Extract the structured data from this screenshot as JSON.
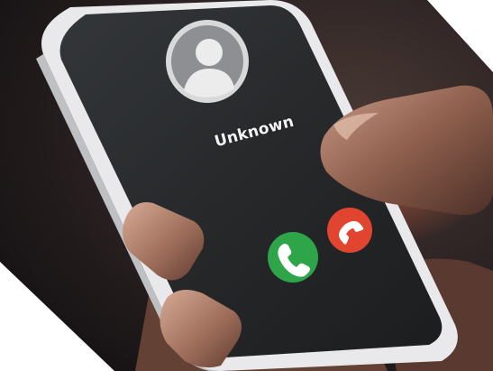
{
  "call_screen": {
    "caller_name": "Unknown",
    "avatar_icon": "person-silhouette-icon",
    "answer_icon": "phone-answer-icon",
    "decline_icon": "phone-decline-icon",
    "answer_color": "#2fa54a",
    "decline_color": "#e2452f",
    "screen_color": "#222426"
  }
}
